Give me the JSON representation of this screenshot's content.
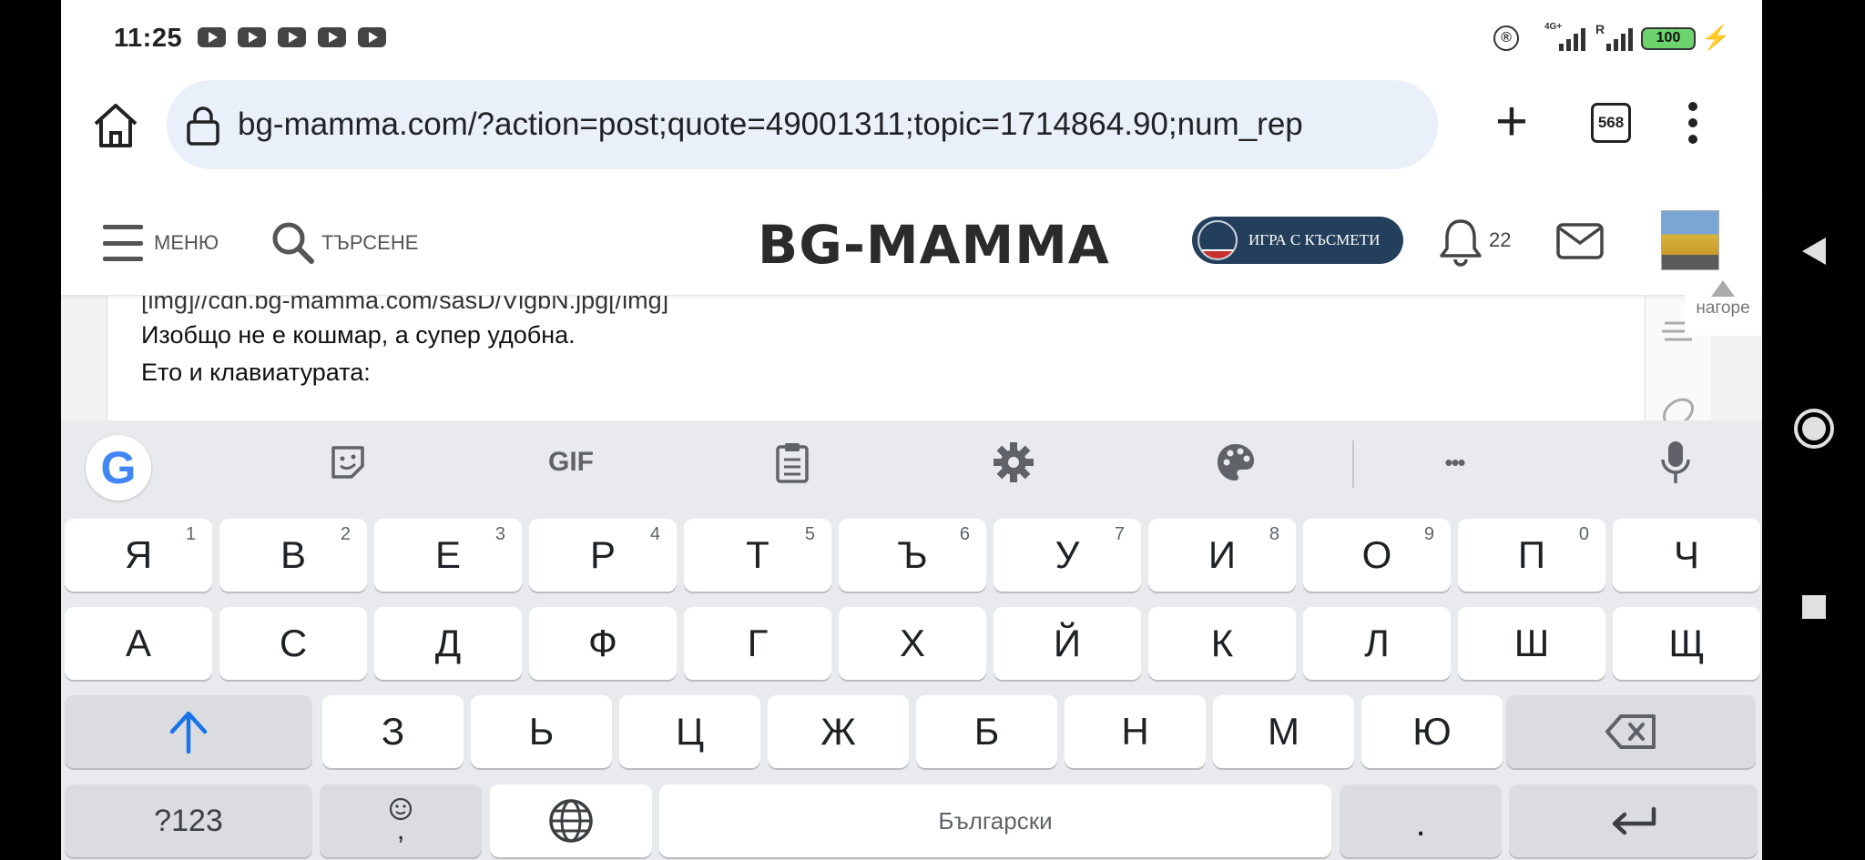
{
  "status_bar": {
    "time": "11:25",
    "notification_icons": [
      "youtube-icon",
      "youtube-icon",
      "youtube-icon",
      "youtube-icon",
      "youtube-icon"
    ],
    "registered_icon": "®",
    "network1_label": "4G+",
    "network2_label": "R",
    "battery": "100"
  },
  "browser": {
    "url": "bg-mamma.com/?action=post;quote=49001311;topic=1714864.90;num_rep",
    "tab_count": "568"
  },
  "site_header": {
    "menu_label": "МЕНЮ",
    "search_label": "ТЪРСЕНЕ",
    "logo": "BG-MAMMA",
    "game_button": "ИГРА С КЪСМЕТИ",
    "notifications_count": "22"
  },
  "post_editor": {
    "line_partial": "[img]//cdn.bg-mamma.com/sasD/VlgbN.jpg[/img]",
    "line1": "Изобщо не е кошмар, а супер удобна.",
    "line2": "Ето и клавиатурата:"
  },
  "back_to_top": "нагоре",
  "keyboard": {
    "row1": [
      {
        "key": "Я",
        "hint": "1"
      },
      {
        "key": "В",
        "hint": "2"
      },
      {
        "key": "Е",
        "hint": "3"
      },
      {
        "key": "Р",
        "hint": "4"
      },
      {
        "key": "Т",
        "hint": "5"
      },
      {
        "key": "Ъ",
        "hint": "6"
      },
      {
        "key": "У",
        "hint": "7"
      },
      {
        "key": "И",
        "hint": "8"
      },
      {
        "key": "О",
        "hint": "9"
      },
      {
        "key": "П",
        "hint": "0"
      },
      {
        "key": "Ч",
        "hint": ""
      }
    ],
    "row2": [
      "А",
      "С",
      "Д",
      "Ф",
      "Г",
      "Х",
      "Й",
      "К",
      "Л",
      "Ш",
      "Щ"
    ],
    "row3": [
      "З",
      "Ь",
      "Ц",
      "Ж",
      "Б",
      "Н",
      "М",
      "Ю"
    ],
    "symbols_key": "?123",
    "emoji_comma_key": ",",
    "space_label": "Български",
    "period_key": ".",
    "toolbar_gif": "GIF",
    "toolbar_more": "•••"
  },
  "colors": {
    "accent_blue": "#1a73e8",
    "game_button_bg": "#233f5b",
    "battery_green": "#6dd46d",
    "keyboard_bg": "#e8eaed"
  }
}
